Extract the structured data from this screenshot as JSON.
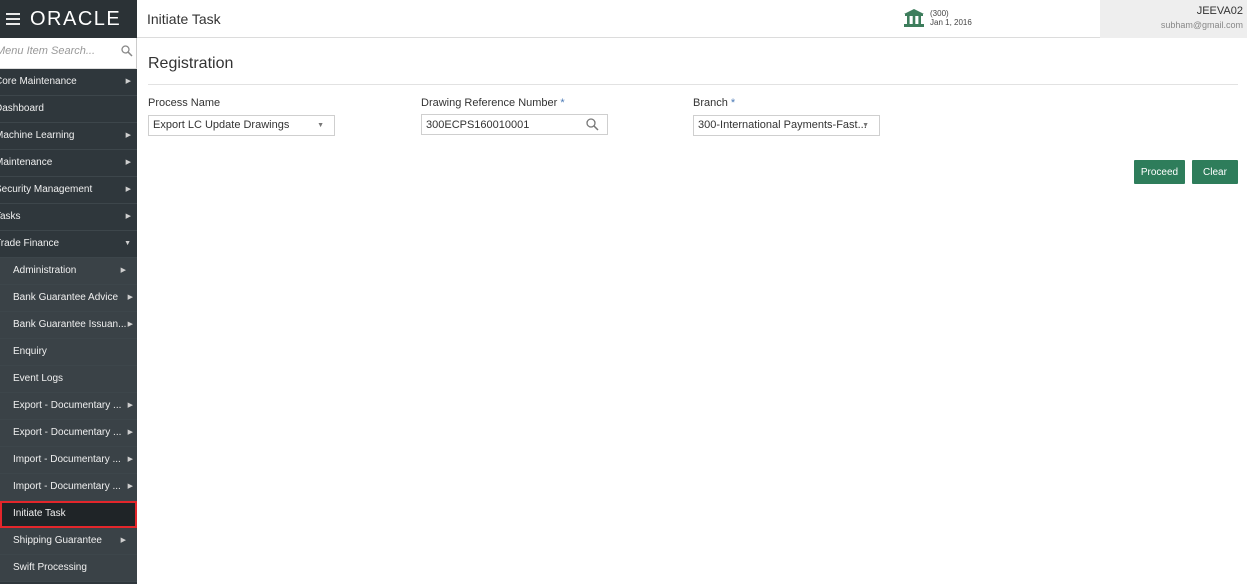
{
  "brand": {
    "logo_text": "ORACLE"
  },
  "header": {
    "title": "Initiate Task",
    "branch_code": "(300)",
    "branch_date": "Jan 1, 2016",
    "user_name": "JEEVA02",
    "user_email": "subham@gmail.com"
  },
  "sidebar": {
    "search_placeholder": "Menu Item Search...",
    "items": [
      {
        "label": "Core Maintenance",
        "arrow": "▶"
      },
      {
        "label": "Dashboard",
        "arrow": ""
      },
      {
        "label": "Machine Learning",
        "arrow": "▶"
      },
      {
        "label": "Maintenance",
        "arrow": "▶"
      },
      {
        "label": "Security Management",
        "arrow": "▶"
      },
      {
        "label": "Tasks",
        "arrow": "▶"
      },
      {
        "label": "Trade Finance",
        "arrow": "▼"
      }
    ],
    "sub_items": [
      {
        "label": "Administration",
        "arrow": "▶"
      },
      {
        "label": "Bank Guarantee Advice",
        "arrow": "▶"
      },
      {
        "label": "Bank Guarantee Issuan...",
        "arrow": "▶"
      },
      {
        "label": "Enquiry",
        "arrow": ""
      },
      {
        "label": "Event Logs",
        "arrow": ""
      },
      {
        "label": "Export - Documentary ...",
        "arrow": "▶"
      },
      {
        "label": "Export - Documentary ...",
        "arrow": "▶"
      },
      {
        "label": "Import - Documentary ...",
        "arrow": "▶"
      },
      {
        "label": "Import - Documentary ...",
        "arrow": "▶"
      },
      {
        "label": "Initiate Task",
        "arrow": ""
      },
      {
        "label": "Shipping Guarantee",
        "arrow": "▶"
      },
      {
        "label": "Swift Processing",
        "arrow": ""
      }
    ]
  },
  "main": {
    "section_title": "Registration",
    "process_name": {
      "label": "Process Name",
      "value": "Export LC Update Drawings",
      "caret": "▼"
    },
    "drawing_ref": {
      "label": "Drawing Reference Number",
      "required": "*",
      "value": "300ECPS160010001"
    },
    "branch": {
      "label": "Branch",
      "required": "*",
      "value": "300-International Payments-Fast...",
      "caret": "▼"
    },
    "buttons": {
      "proceed": "Proceed",
      "clear": "Clear"
    }
  },
  "colors": {
    "sidebar_bg": "#2f373c",
    "button_green": "#2e7d5b",
    "active_outline": "#e3262b",
    "required_star": "#4a7ab6"
  }
}
